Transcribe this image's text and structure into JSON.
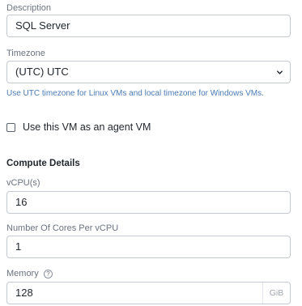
{
  "description": {
    "label": "Description",
    "value": "SQL Server"
  },
  "timezone": {
    "label": "Timezone",
    "selected": "(UTC) UTC",
    "hint": "Use UTC timezone for Linux VMs and local timezone for Windows VMs."
  },
  "agent_vm": {
    "label": "Use this VM as an agent VM",
    "checked": false
  },
  "compute": {
    "title": "Compute Details",
    "vcpus": {
      "label": "vCPU(s)",
      "value": "16"
    },
    "cores_per_vcpu": {
      "label": "Number Of Cores Per vCPU",
      "value": "1"
    },
    "memory": {
      "label": "Memory",
      "help": "?",
      "value": "128",
      "unit": "GiB"
    }
  },
  "icons": {
    "select_arrow": "chevron-down-icon",
    "help": "help-circle-icon"
  }
}
